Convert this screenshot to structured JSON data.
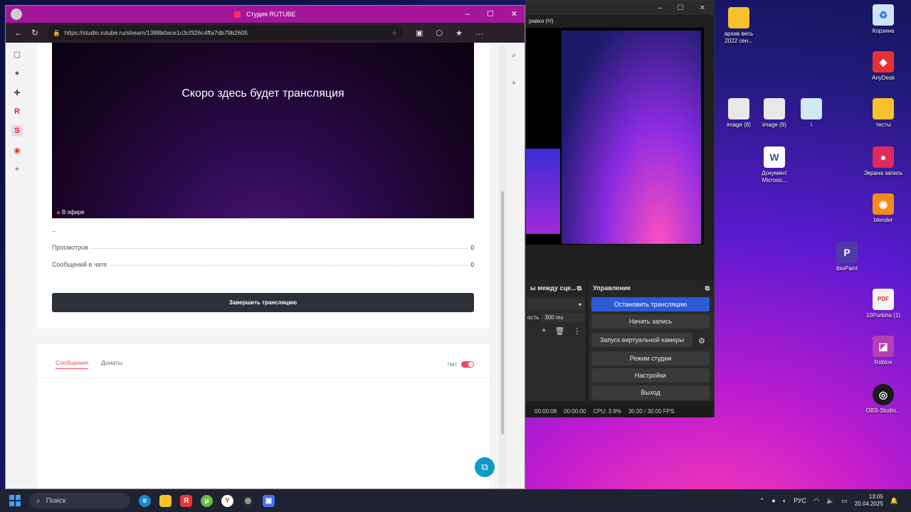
{
  "browser": {
    "tab_title": "Студия RUTUBE",
    "url": "https://studio.rutube.ru/stream/1388b0ace1c3cf326c4ffa7db79b2605",
    "window_controls": {
      "minimize": "–",
      "maximize": "☐",
      "close": "✕"
    }
  },
  "stream": {
    "video_message": "Скоро здесь будет трансляция",
    "live_label": "В эфире",
    "description": "..",
    "stats": [
      {
        "label": "Просмотров",
        "value": "0"
      },
      {
        "label": "Сообщений в чате",
        "value": "0"
      }
    ],
    "end_button": "Завершить трансляцию"
  },
  "chat": {
    "tabs": [
      "Сообщения",
      "Донаты"
    ],
    "toggle_label": "Чат",
    "toggle_on": true
  },
  "obs": {
    "controls_title": "Управление",
    "scenes_title": "ы между сце...",
    "transition_value": "300 ms",
    "transition_label": "ость",
    "buttons": [
      "Остановить трансляцию",
      "Начать запись",
      "Запуск виртуальной камеры",
      "Режим студии",
      "Настройки",
      "Выход"
    ],
    "status": {
      "time_live": "00:00:08",
      "time_rec": "00:00:00",
      "cpu": "CPU: 3.9%",
      "fps": "30.00 / 30.00 FPS"
    },
    "menu_text": "равка (Н)"
  },
  "desktop": {
    "icons": [
      {
        "label": "архив весь 2022 сен...",
        "color": "#f6c12b",
        "glyph": ""
      },
      {
        "label": "Корзина",
        "color": "#d0e4f7",
        "glyph": "♻"
      },
      {
        "label": "AnyDesk",
        "color": "#e5312f",
        "glyph": "◆"
      },
      {
        "label": "image (8)",
        "color": "#e8e8e8",
        "glyph": ""
      },
      {
        "label": "image (9)",
        "color": "#e8e8e8",
        "glyph": ""
      },
      {
        "label": "i",
        "color": "#cfeaf5",
        "glyph": ""
      },
      {
        "label": "тесты",
        "color": "#f6c12b",
        "glyph": ""
      },
      {
        "label": "Документ Microso...",
        "color": "#ffffff",
        "glyph": "W"
      },
      {
        "label": "Экрана запись",
        "color": "#e02a5a",
        "glyph": "●"
      },
      {
        "label": "blender",
        "color": "#f08b1c",
        "glyph": "◉"
      },
      {
        "label": "ibisPaint",
        "color": "#4f3ba8",
        "glyph": "P"
      },
      {
        "label": "10Purkina (1)",
        "color": "#f5f5f5",
        "glyph": "PDF"
      },
      {
        "label": "Roblox",
        "color": "#b53fb3",
        "glyph": "◪"
      },
      {
        "label": "OBS-Studio...",
        "color": "#1a1a1a",
        "glyph": "◎"
      }
    ]
  },
  "taskbar": {
    "search_placeholder": "Поиск",
    "language": "РУС",
    "time": "13:05",
    "date": "20.04.2025"
  }
}
